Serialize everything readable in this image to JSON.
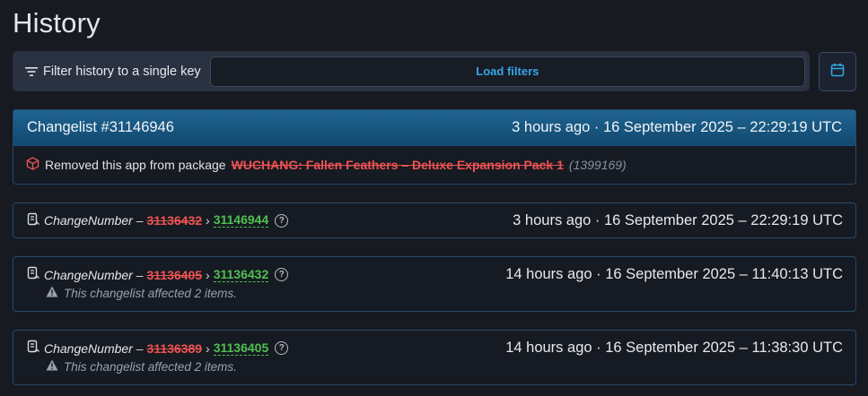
{
  "page": {
    "title": "History"
  },
  "filter": {
    "label": "Filter history to a single key",
    "load_label": "Load filters"
  },
  "changelist": {
    "title": "Changelist #31146946",
    "time": "3 hours ago · 16 September 2025 – 22:29:19 UTC",
    "message": "Removed this app from package",
    "package_name": "WUCHANG: Fallen Feathers – Deluxe Expansion Pack 1",
    "package_id": "(1399169)"
  },
  "changes": [
    {
      "key": "ChangeNumber –",
      "old": "31136432",
      "arrow": "›",
      "new": "31146944",
      "help": "?",
      "time": "3 hours ago · 16 September 2025 – 22:29:19 UTC",
      "note": ""
    },
    {
      "key": "ChangeNumber –",
      "old": "31136405",
      "arrow": "›",
      "new": "31136432",
      "help": "?",
      "time": "14 hours ago · 16 September 2025 – 11:40:13 UTC",
      "note": "This changelist affected 2 items."
    },
    {
      "key": "ChangeNumber –",
      "old": "31136389",
      "arrow": "›",
      "new": "31136405",
      "help": "?",
      "time": "14 hours ago · 16 September 2025 – 11:38:30 UTC",
      "note": "This changelist affected 2 items."
    }
  ],
  "colors": {
    "background": "#171a21",
    "accent": "#35a6e6",
    "removed": "#ee5353",
    "added": "#4fc051",
    "header": "#1f6591"
  },
  "icons": [
    "filter-icon",
    "calendar-icon",
    "package-icon",
    "changelist-icon",
    "help-icon",
    "warning-icon"
  ]
}
